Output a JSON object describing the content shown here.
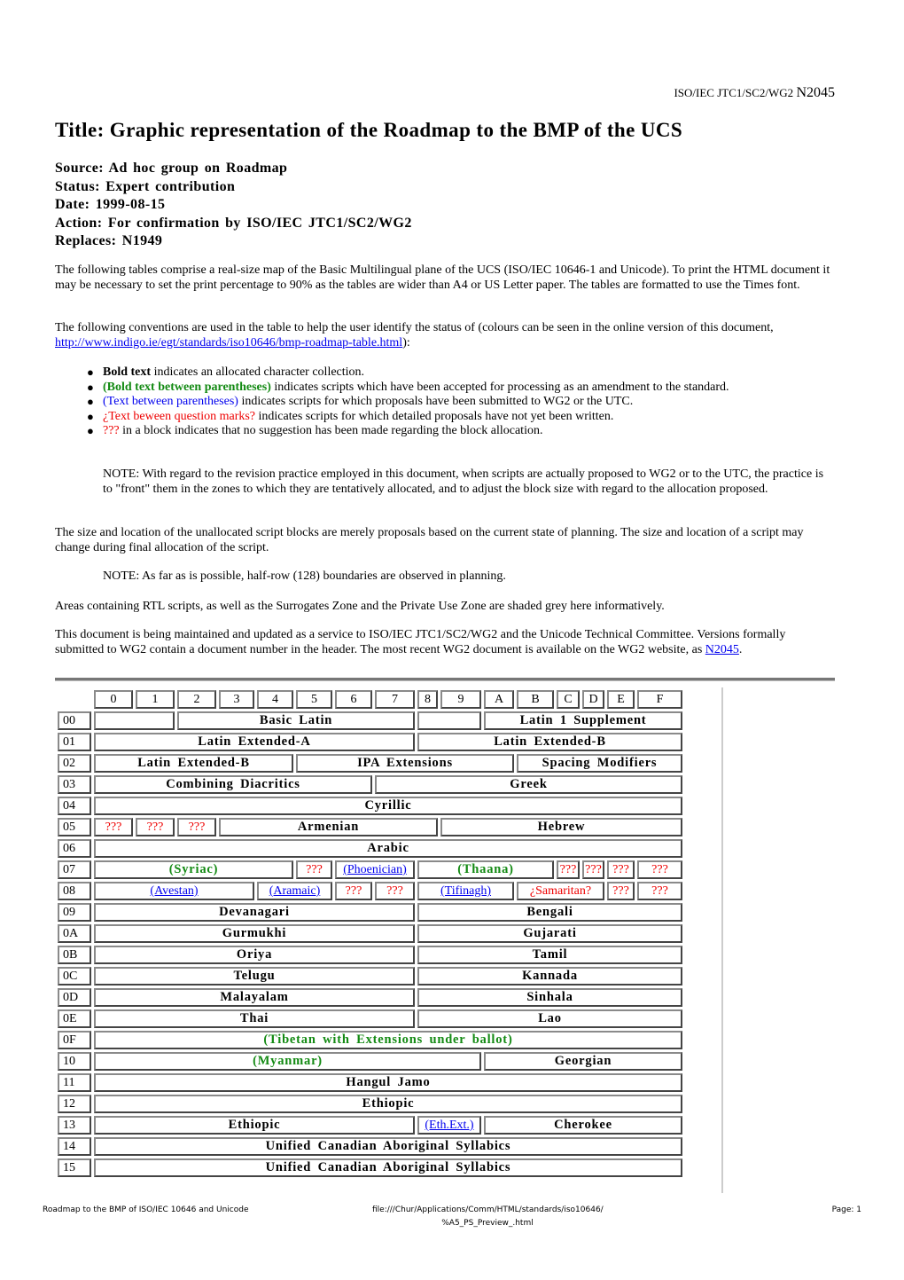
{
  "header": {
    "doc_ref": "ISO/IEC JTC1/SC2/WG2",
    "doc_number": "N2045"
  },
  "title": "Title: Graphic representation of the Roadmap to the BMP of the UCS",
  "meta": [
    {
      "label": "Source:",
      "value": "Ad hoc group on Roadmap"
    },
    {
      "label": "Status:",
      "value": "Expert contribution"
    },
    {
      "label": "Date:",
      "value": "1999-08-15"
    },
    {
      "label": "Action:",
      "value": "For confirmation by ISO/IEC JTC1/SC2/WG2"
    },
    {
      "label": "Replaces:",
      "value": "N1949"
    }
  ],
  "intro": "The following tables comprise a real-size map of the Basic Multilingual plane of the UCS (ISO/IEC 10646-1 and Unicode). To print the HTML document it may be necessary to set the print percentage to 90% as the tables are wider than A4 or US Letter paper. The tables are formatted to use the Times font.",
  "conventions_intro": {
    "before": "The following conventions are used in the table to help the user identify the status of (colours can be seen in the online version of this document, ",
    "link": "http://www.indigo.ie/egt/standards/iso10646/bmp-roadmap-table.html",
    "after": "):"
  },
  "conventions": [
    {
      "marker": "Bold text",
      "style": "bold",
      "text": " indicates an allocated character collection."
    },
    {
      "marker": "(Bold text between parentheses)",
      "style": "green",
      "text": " indicates scripts which have been accepted for processing as an amendment to the standard."
    },
    {
      "marker": "(Text between parentheses)",
      "style": "blue",
      "text": " indicates scripts for which proposals have been submitted to WG2 or the UTC."
    },
    {
      "marker": "¿Text beween question marks?",
      "style": "red",
      "text": " indicates scripts for which detailed proposals have not yet been written."
    },
    {
      "marker": "???",
      "style": "red",
      "text": " in a block indicates that no suggestion has been made regarding the block allocation."
    }
  ],
  "note1": "NOTE: With regard to the revision practice employed in this document, when scripts are actually proposed to WG2 or to the UTC, the practice is to \"front\" them in the zones to which they are tentatively allocated, and to adjust the block size with regard to the allocation proposed.",
  "para_size": "The size and location of the unallocated script blocks are merely proposals based on the current state of planning. The size and location of a script may change during final allocation of the script.",
  "note2": "NOTE: As far as is possible, half-row (128) boundaries are observed in planning.",
  "para_rtl": "Areas containing RTL scripts, as well as the Surrogates Zone and the Private Use Zone are shaded grey here informatively.",
  "para_maintained": {
    "before": "This document is being maintained and updated as a service to ISO/IEC JTC1/SC2/WG2 and the Unicode Technical Committee. Versions formally submitted to WG2 contain a document number in the header. The most recent WG2 document is available on the WG2 website, as ",
    "link": "N2045",
    "after": "."
  },
  "colors": {
    "accepted_green": "#138a13",
    "proposed_blue": "#0000ee",
    "unwritten_red": "#ee0000"
  },
  "table": {
    "column_headers": [
      "0",
      "1",
      "2",
      "3",
      "4",
      "5",
      "6",
      "7",
      "8",
      "9",
      "A",
      "B",
      "C",
      "D",
      "E",
      "F"
    ],
    "rows": [
      {
        "row": "00",
        "cells": [
          {
            "span": 2,
            "text": "",
            "status": "empty"
          },
          {
            "span": 6,
            "text": "Basic Latin",
            "status": "allocated"
          },
          {
            "span": 2,
            "text": "",
            "status": "empty"
          },
          {
            "span": 6,
            "text": "Latin 1 Supplement",
            "status": "allocated"
          }
        ]
      },
      {
        "row": "01",
        "cells": [
          {
            "span": 8,
            "text": "Latin Extended-A",
            "status": "allocated"
          },
          {
            "span": 8,
            "text": "Latin Extended-B",
            "status": "allocated"
          }
        ]
      },
      {
        "row": "02",
        "cells": [
          {
            "span": 5,
            "text": "Latin Extended-B",
            "status": "allocated"
          },
          {
            "span": 6,
            "text": "IPA Extensions",
            "status": "allocated"
          },
          {
            "span": 5,
            "text": "Spacing Modifiers",
            "status": "allocated"
          }
        ]
      },
      {
        "row": "03",
        "cells": [
          {
            "span": 7,
            "text": "Combining Diacritics",
            "status": "allocated"
          },
          {
            "span": 9,
            "text": "Greek",
            "status": "allocated"
          }
        ]
      },
      {
        "row": "04",
        "cells": [
          {
            "span": 16,
            "text": "Cyrillic",
            "status": "allocated"
          }
        ]
      },
      {
        "row": "05",
        "cells": [
          {
            "span": 1,
            "text": "???",
            "status": "unknown"
          },
          {
            "span": 1,
            "text": "???",
            "status": "unknown"
          },
          {
            "span": 1,
            "text": "???",
            "status": "unknown"
          },
          {
            "span": 6,
            "text": "Armenian",
            "status": "allocated"
          },
          {
            "span": 7,
            "text": "Hebrew",
            "status": "allocated"
          }
        ]
      },
      {
        "row": "06",
        "cells": [
          {
            "span": 16,
            "text": "Arabic",
            "status": "allocated"
          }
        ]
      },
      {
        "row": "07",
        "cells": [
          {
            "span": 5,
            "text": "(Syriac)",
            "status": "accepted"
          },
          {
            "span": 1,
            "text": "???",
            "status": "unknown"
          },
          {
            "span": 2,
            "text": "(Phoenician)",
            "status": "proposed"
          },
          {
            "span": 4,
            "text": "(Thaana)",
            "status": "accepted"
          },
          {
            "span": 1,
            "text": "???",
            "status": "unknown"
          },
          {
            "span": 1,
            "text": "???",
            "status": "unknown"
          },
          {
            "span": 1,
            "text": "???",
            "status": "unknown"
          },
          {
            "span": 1,
            "text": "???",
            "status": "unknown"
          }
        ]
      },
      {
        "row": "08",
        "cells": [
          {
            "span": 4,
            "text": "(Avestan)",
            "status": "proposed"
          },
          {
            "span": 2,
            "text": "(Aramaic)",
            "status": "proposed"
          },
          {
            "span": 1,
            "text": "???",
            "status": "unknown"
          },
          {
            "span": 1,
            "text": "???",
            "status": "unknown"
          },
          {
            "span": 3,
            "text": "(Tifinagh)",
            "status": "proposed"
          },
          {
            "span": 3,
            "text": "¿Samaritan?",
            "status": "unwritten"
          },
          {
            "span": 1,
            "text": "???",
            "status": "unknown"
          },
          {
            "span": 1,
            "text": "???",
            "status": "unknown"
          }
        ]
      },
      {
        "row": "09",
        "cells": [
          {
            "span": 8,
            "text": "Devanagari",
            "status": "allocated"
          },
          {
            "span": 8,
            "text": "Bengali",
            "status": "allocated"
          }
        ]
      },
      {
        "row": "0A",
        "cells": [
          {
            "span": 8,
            "text": "Gurmukhi",
            "status": "allocated"
          },
          {
            "span": 8,
            "text": "Gujarati",
            "status": "allocated"
          }
        ]
      },
      {
        "row": "0B",
        "cells": [
          {
            "span": 8,
            "text": "Oriya",
            "status": "allocated"
          },
          {
            "span": 8,
            "text": "Tamil",
            "status": "allocated"
          }
        ]
      },
      {
        "row": "0C",
        "cells": [
          {
            "span": 8,
            "text": "Telugu",
            "status": "allocated"
          },
          {
            "span": 8,
            "text": "Kannada",
            "status": "allocated"
          }
        ]
      },
      {
        "row": "0D",
        "cells": [
          {
            "span": 8,
            "text": "Malayalam",
            "status": "allocated"
          },
          {
            "span": 8,
            "text": "Sinhala",
            "status": "allocated"
          }
        ]
      },
      {
        "row": "0E",
        "cells": [
          {
            "span": 8,
            "text": "Thai",
            "status": "allocated"
          },
          {
            "span": 8,
            "text": "Lao",
            "status": "allocated"
          }
        ]
      },
      {
        "row": "0F",
        "cells": [
          {
            "span": 16,
            "text": "(Tibetan with Extensions under ballot)",
            "status": "accepted"
          }
        ]
      },
      {
        "row": "10",
        "cells": [
          {
            "span": 10,
            "text": "(Myanmar)",
            "status": "accepted"
          },
          {
            "span": 6,
            "text": "Georgian",
            "status": "allocated"
          }
        ]
      },
      {
        "row": "11",
        "cells": [
          {
            "span": 16,
            "text": "Hangul Jamo",
            "status": "allocated"
          }
        ]
      },
      {
        "row": "12",
        "cells": [
          {
            "span": 16,
            "text": "Ethiopic",
            "status": "allocated"
          }
        ]
      },
      {
        "row": "13",
        "cells": [
          {
            "span": 8,
            "text": "Ethiopic",
            "status": "allocated"
          },
          {
            "span": 2,
            "text": "(Eth.Ext.)",
            "status": "proposed"
          },
          {
            "span": 6,
            "text": "Cherokee",
            "status": "allocated"
          }
        ]
      },
      {
        "row": "14",
        "cells": [
          {
            "span": 16,
            "text": "Unified Canadian Aboriginal Syllabics",
            "status": "allocated"
          }
        ]
      },
      {
        "row": "15",
        "cells": [
          {
            "span": 16,
            "text": "Unified Canadian Aboriginal Syllabics",
            "status": "allocated"
          }
        ]
      }
    ]
  },
  "footer": {
    "left": "Roadmap to the BMP of ISO/IEC 10646 and Unicode",
    "middle_line1": "file:///Chur/Applications/Comm/HTML/standards/iso10646/",
    "middle_line2": "%A5_PS_Preview_.html",
    "right": "Page: 1"
  }
}
